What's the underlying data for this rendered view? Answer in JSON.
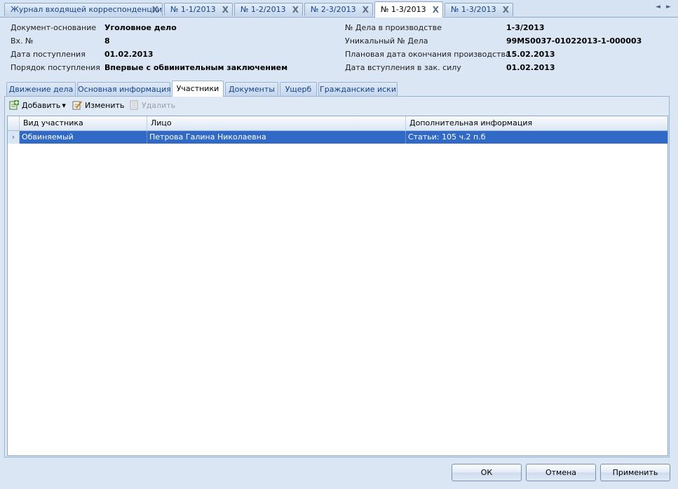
{
  "doc_tabs": [
    {
      "label": "Журнал входящей корреспонденции"
    },
    {
      "label": "№ 1-1/2013"
    },
    {
      "label": "№ 1-2/2013"
    },
    {
      "label": "№ 2-3/2013"
    },
    {
      "label": "№ 1-3/2013",
      "active": true
    },
    {
      "label": "№ 1-3/2013"
    }
  ],
  "tab_close_glyph": "X",
  "nav_prev_glyph": "◄",
  "nav_next_glyph": "►",
  "header_fields": {
    "left": [
      {
        "label": "Документ-основание",
        "value": "Уголовное дело"
      },
      {
        "label": "Вх. №",
        "value": "8"
      },
      {
        "label": "Дата поступления",
        "value": "01.02.2013"
      },
      {
        "label": "Порядок поступления",
        "value": "Впервые с обвинительным заключением"
      }
    ],
    "right": [
      {
        "label": "№ Дела в производстве",
        "value": "1-3/2013"
      },
      {
        "label": "Уникальный № Дела",
        "value": "99MS0037-01022013-1-000003"
      },
      {
        "label": "Плановая дата окончания производства",
        "value": "15.02.2013"
      },
      {
        "label": "Дата вступления в зак. силу",
        "value": "01.02.2013"
      }
    ]
  },
  "inner_tabs": [
    {
      "label": "Движение дела"
    },
    {
      "label": "Основная информация"
    },
    {
      "label": "Участники",
      "active": true
    },
    {
      "label": "Документы"
    },
    {
      "label": "Ущерб"
    },
    {
      "label": "Гражданские иски"
    }
  ],
  "toolbar": {
    "add_label": "Добавить",
    "add_dropdown_glyph": "▾",
    "edit_label": "Изменить",
    "delete_label": "Удалить",
    "delete_enabled": false
  },
  "grid": {
    "columns": [
      "Вид участника",
      "Лицо",
      "Дополнительная информация"
    ],
    "row_indicator": "›",
    "rows": [
      {
        "type": "Обвиняемый",
        "person": "Петрова Галина Николаевна",
        "info": "Статьи: 105 ч.2 п.б",
        "selected": true
      }
    ]
  },
  "buttons": {
    "ok": "ОК",
    "cancel": "Отмена",
    "apply": "Применить"
  },
  "colors": {
    "selection": "#3169c6",
    "tab_text": "#15428b"
  }
}
